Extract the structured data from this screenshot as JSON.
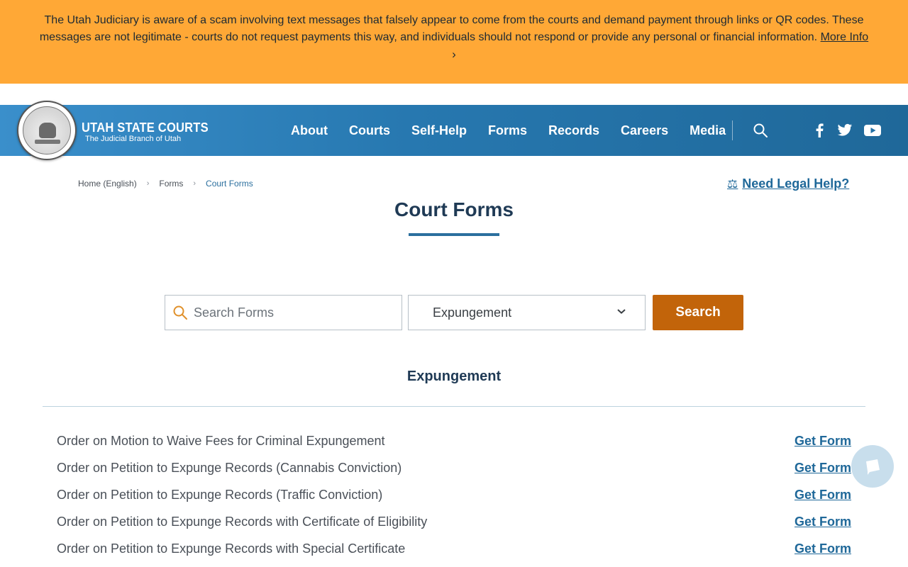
{
  "alert": {
    "message": "The Utah Judiciary is aware of a scam involving text messages that falsely appear to come from the courts and demand payment through links or QR codes. These messages are not legitimate - courts do not request payments this way, and individuals should not respond or provide any personal or financial information.",
    "link_label": "More Info",
    "chevron": "›",
    "background": "#ffa836"
  },
  "header": {
    "brand_title": "UTAH STATE COURTS",
    "brand_subtitle": "The Judicial Branch of Utah",
    "nav": [
      "About",
      "Courts",
      "Self-Help",
      "Forms",
      "Records",
      "Careers",
      "Media"
    ],
    "icons": [
      "search-icon",
      "facebook-icon",
      "twitter-icon",
      "youtube-icon"
    ]
  },
  "breadcrumb": {
    "items": [
      "Home (English)",
      "Forms",
      "Court Forms"
    ],
    "separator": "›"
  },
  "legal_help": {
    "label": "Need Legal Help?",
    "icon": "⚖"
  },
  "page": {
    "title": "Court Forms"
  },
  "search": {
    "placeholder": "Search Forms",
    "category_selected": "Expungement",
    "button_label": "Search",
    "button_color": "#c2640a"
  },
  "results": {
    "heading": "Expungement",
    "action_label": "Get Form",
    "forms": [
      "Order on Motion to Waive Fees for Criminal Expungement",
      "Order on Petition to Expunge Records (Cannabis Conviction)",
      "Order on Petition to Expunge Records (Traffic Conviction)",
      "Order on Petition to Expunge Records with Certificate of Eligibility",
      "Order on Petition to Expunge Records with Special Certificate"
    ]
  },
  "colors": {
    "header_blue": "#2778b0",
    "link_blue": "#1f6899",
    "title_navy": "#1f3a55"
  }
}
